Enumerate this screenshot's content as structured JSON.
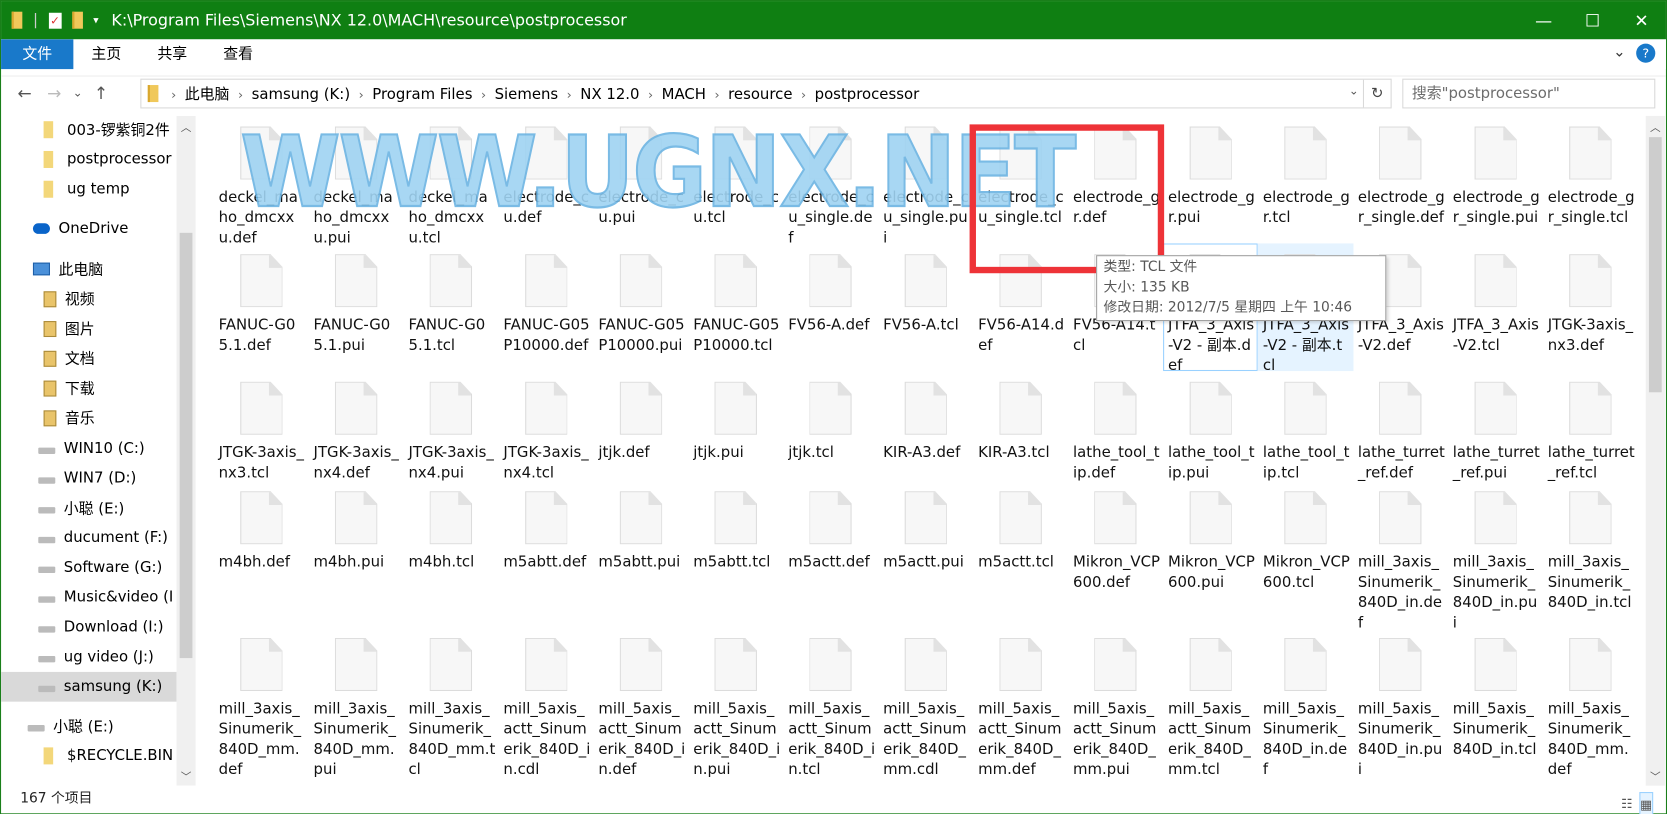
{
  "window": {
    "title": "K:\\Program Files\\Siemens\\NX 12.0\\MACH\\resource\\postprocessor",
    "minimize": "—",
    "maximize": "☐",
    "close": "✕",
    "titlebar_color": "#0f7f12"
  },
  "ribbon": {
    "tabs": [
      "文件",
      "主页",
      "共享",
      "查看"
    ],
    "expand": "⌄",
    "help": "?"
  },
  "nav": {
    "back": "←",
    "forward": "→",
    "recent": "⌄",
    "up": "↑",
    "breadcrumb": [
      "此电脑",
      "samsung (K:)",
      "Program Files",
      "Siemens",
      "NX 12.0",
      "MACH",
      "resource",
      "postprocessor"
    ],
    "search_placeholder": "搜索\"postprocessor\""
  },
  "sidebar": {
    "items": [
      {
        "label": "003-锣紫铜2件",
        "icon": "folder-icon"
      },
      {
        "label": "postprocessor",
        "icon": "folder-icon"
      },
      {
        "label": "ug temp",
        "icon": "folder-icon"
      },
      {
        "label": "OneDrive",
        "icon": "cloud-icon"
      },
      {
        "label": "此电脑",
        "icon": "computer-icon"
      },
      {
        "label": "视频",
        "icon": "library-icon"
      },
      {
        "label": "图片",
        "icon": "library-icon"
      },
      {
        "label": "文档",
        "icon": "library-icon"
      },
      {
        "label": "下载",
        "icon": "library-icon"
      },
      {
        "label": "音乐",
        "icon": "library-icon"
      },
      {
        "label": "WIN10 (C:)",
        "icon": "drive-icon"
      },
      {
        "label": "WIN7 (D:)",
        "icon": "drive-icon"
      },
      {
        "label": "小聪 (E:)",
        "icon": "drive-icon"
      },
      {
        "label": "ducument (F:)",
        "icon": "drive-icon"
      },
      {
        "label": "Software (G:)",
        "icon": "drive-icon"
      },
      {
        "label": "Music&video (I",
        "icon": "drive-icon"
      },
      {
        "label": "Download (I:)",
        "icon": "drive-icon"
      },
      {
        "label": "ug video (J:)",
        "icon": "drive-icon"
      },
      {
        "label": "samsung (K:)",
        "icon": "drive-icon",
        "selected": true
      },
      {
        "label": "小聪 (E:)",
        "icon": "drive-icon"
      },
      {
        "label": "$RECYCLE.BIN",
        "icon": "folder-icon"
      }
    ]
  },
  "files": [
    "deckel_maho_dmcxxu.def",
    "deckel_maho_dmcxxu.pui",
    "deckel_maho_dmcxxu.tcl",
    "electrode_cu.def",
    "electrode_cu.pui",
    "electrode_cu.tcl",
    "electrode_cu_single.def",
    "electrode_cu_single.pui",
    "electrode_cu_single.tcl",
    "electrode_gr.def",
    "electrode_gr.pui",
    "electrode_gr.tcl",
    "electrode_gr_single.def",
    "electrode_gr_single.pui",
    "electrode_gr_single.tcl",
    "FANUC-G05.1.def",
    "FANUC-G05.1.pui",
    "FANUC-G05.1.tcl",
    "FANUC-G05P10000.def",
    "FANUC-G05P10000.pui",
    "FANUC-G05P10000.tcl",
    "FV56-A.def",
    "FV56-A.tcl",
    "FV56-A14.def",
    "FV56-A14.tcl",
    "JTFA_3_Axis-V2 - 副本.def",
    "JTFA_3_Axis-V2 - 副本.tcl",
    "JTFA_3_Axis-V2.def",
    "JTFA_3_Axis-V2.tcl",
    "JTGK-3axis_nx3.def",
    "JTGK-3axis_nx3.tcl",
    "JTGK-3axis_nx4.def",
    "JTGK-3axis_nx4.pui",
    "JTGK-3axis_nx4.tcl",
    "jtjk.def",
    "jtjk.pui",
    "jtjk.tcl",
    "KIR-A3.def",
    "KIR-A3.tcl",
    "lathe_tool_tip.def",
    "lathe_tool_tip.pui",
    "lathe_tool_tip.tcl",
    "lathe_turret_ref.def",
    "lathe_turret_ref.pui",
    "lathe_turret_ref.tcl",
    "m4bh.def",
    "m4bh.pui",
    "m4bh.tcl",
    "m5abtt.def",
    "m5abtt.pui",
    "m5abtt.tcl",
    "m5actt.def",
    "m5actt.pui",
    "m5actt.tcl",
    "Mikron_VCP600.def",
    "Mikron_VCP600.pui",
    "Mikron_VCP600.tcl",
    "mill_3axis_Sinumerik_840D_in.def",
    "mill_3axis_Sinumerik_840D_in.pui",
    "mill_3axis_Sinumerik_840D_in.tcl",
    "mill_3axis_Sinumerik_840D_mm.def",
    "mill_3axis_Sinumerik_840D_mm.pui",
    "mill_3axis_Sinumerik_840D_mm.tcl",
    "mill_5axis_actt_Sinumerik_840D_in.cdl",
    "mill_5axis_actt_Sinumerik_840D_in.def",
    "mill_5axis_actt_Sinumerik_840D_in.pui",
    "mill_5axis_actt_Sinumerik_840D_in.tcl",
    "mill_5axis_actt_Sinumerik_840D_mm.cdl",
    "mill_5axis_actt_Sinumerik_840D_mm.def",
    "mill_5axis_actt_Sinumerik_840D_mm.pui",
    "mill_5axis_actt_Sinumerik_840D_mm.tcl",
    "mill_5axis_Sinumerik_840D_in.def",
    "mill_5axis_Sinumerik_840D_in.pui",
    "mill_5axis_Sinumerik_840D_in.tcl",
    "mill_5axis_Sinumerik_840D_mm.def"
  ],
  "hovered_file": "JTFA_3_Axis-V2 - 副本.def",
  "selected_file": "JTFA_3_Axis-V2 - 副本.tcl",
  "tooltip": {
    "type": "类型: TCL 文件",
    "size": "大小: 135 KB",
    "modified": "修改日期: 2012/7/5 星期四 上午 10:46"
  },
  "watermark": "WWW.UGNX.NET",
  "annotation_color": "#ee3338",
  "status": {
    "count": "167 个项目",
    "details_view": "☷",
    "icons_view": "▦"
  }
}
